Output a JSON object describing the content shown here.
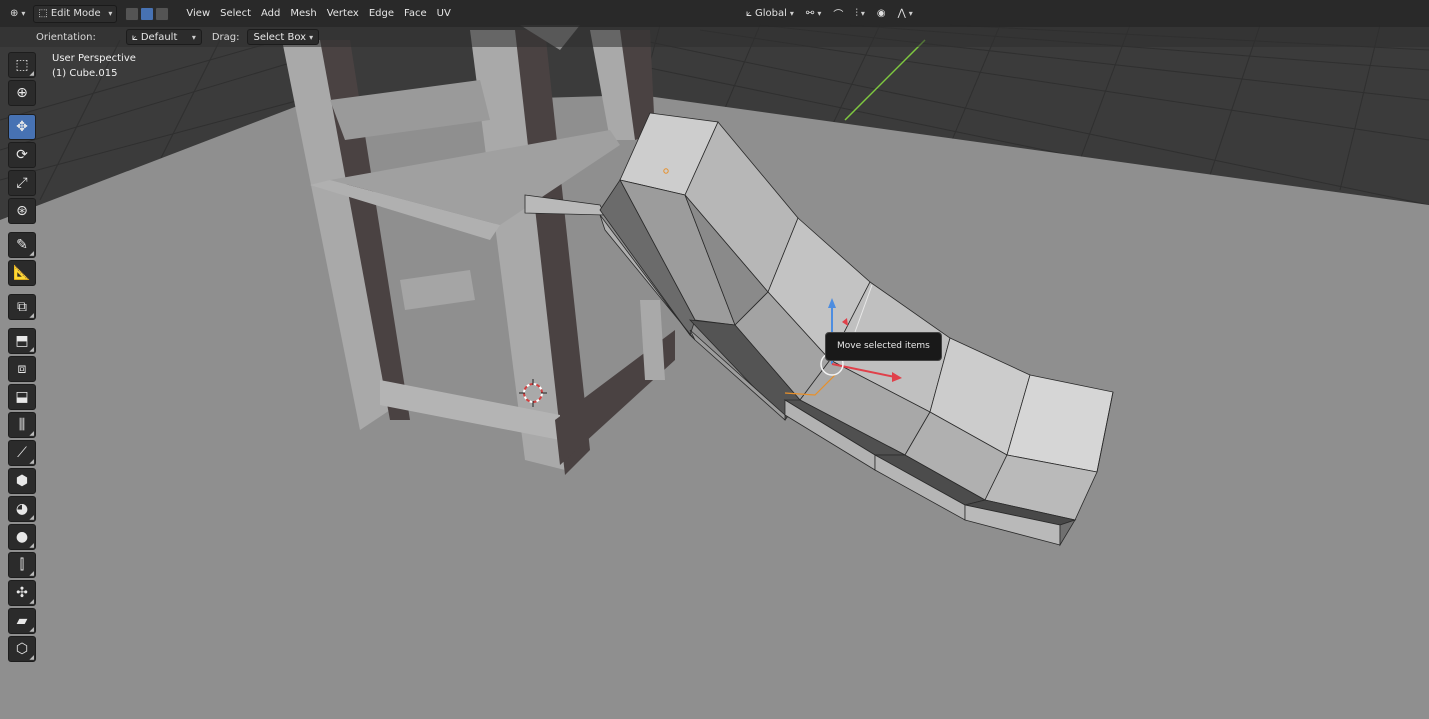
{
  "header": {
    "editor_type_icon": "editor-type-icon",
    "mode": {
      "label": "Edit Mode",
      "icon": "edit-mode-icon"
    },
    "select_modes": [
      {
        "name": "vertex-select-mode",
        "active": false
      },
      {
        "name": "edge-select-mode",
        "active": true
      },
      {
        "name": "face-select-mode",
        "active": false
      }
    ],
    "menus": [
      "View",
      "Select",
      "Add",
      "Mesh",
      "Vertex",
      "Edge",
      "Face",
      "UV"
    ],
    "transform_orientation": {
      "label": "Global",
      "icon": "transform-orientation-icon"
    },
    "pivot_icon": "pivot-point-icon",
    "snap_icon": "snap-icon",
    "snap_increment_icon": "snap-increment-icon",
    "proportional_icon": "proportional-edit-icon",
    "falloff_icon": "proportional-falloff-icon"
  },
  "tool_settings": {
    "orientation_label": "Orientation:",
    "orientation_value": "Default",
    "drag_label": "Drag:",
    "drag_value": "Select Box"
  },
  "overlay": {
    "view_name": "User Perspective",
    "object_name": "(1) Cube.015"
  },
  "tooltip": "Move selected items",
  "tools": [
    "select-box-tool",
    "cursor-tool",
    "move-tool",
    "rotate-tool",
    "scale-tool",
    "transform-tool",
    "annotate-tool",
    "measure-tool",
    "add-cube-tool",
    "extrude-region-tool",
    "inset-faces-tool",
    "bevel-tool",
    "loop-cut-tool",
    "knife-tool",
    "poly-build-tool",
    "spin-tool",
    "smooth-tool",
    "edge-slide-tool",
    "shrink-fatten-tool",
    "shear-tool",
    "rip-region-tool"
  ],
  "active_tool": "move-tool",
  "colors": {
    "accent": "#4772b3",
    "floor": "#8f8f8f",
    "background": "#3a3a3a",
    "x_axis": "#e0404a",
    "y_axis": "#7fc940",
    "z_axis": "#4d8de0",
    "selection": "#e8902a"
  }
}
